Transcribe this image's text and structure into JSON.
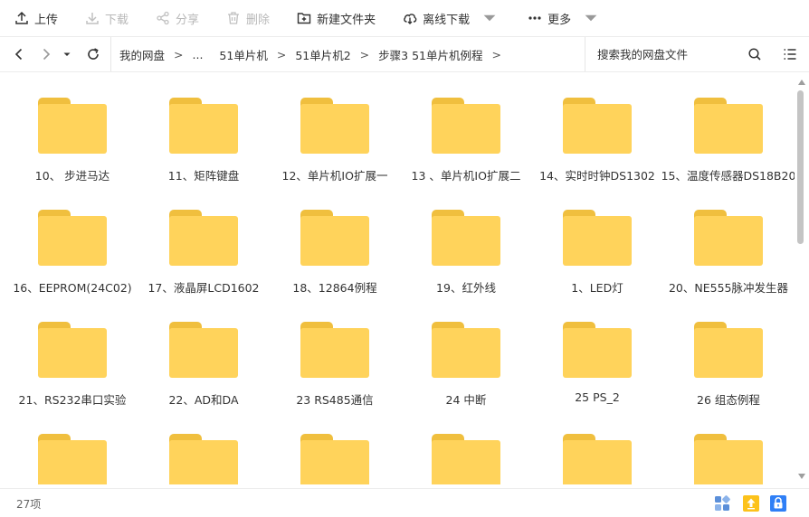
{
  "toolbar": {
    "upload": "上传",
    "download": "下载",
    "share": "分享",
    "delete": "删除",
    "new_folder": "新建文件夹",
    "offline_download": "离线下载",
    "more": "更多"
  },
  "breadcrumb": {
    "root": "我的网盘",
    "ellipsis": "...",
    "items": [
      "51单片机",
      "51单片机2",
      "步骤3 51单片机例程"
    ],
    "separator": ">"
  },
  "search": {
    "placeholder": "搜索我的网盘文件"
  },
  "files": [
    "10、 步进马达",
    "11、矩阵键盘",
    "12、单片机IO扩展一",
    "13 、单片机IO扩展二",
    "14、实时时钟DS1302",
    "15、温度传感器DS18B20",
    "16、EEPROM(24C02)",
    "17、液晶屏LCD1602",
    "18、12864例程",
    "19、红外线",
    "1、LED灯",
    "20、NE555脉冲发生器",
    "21、RS232串口实验",
    "22、AD和DA",
    "23 RS485通信",
    "24 中断",
    "25  PS_2",
    "26 组态例程",
    "",
    "",
    "",
    "",
    "",
    ""
  ],
  "status": {
    "count": "27项"
  },
  "colors": {
    "folder_body": "#ffd35b",
    "folder_tab": "#f0bf3e",
    "accent": "#2f7ff6",
    "upload_yellow": "#fcc21b"
  }
}
